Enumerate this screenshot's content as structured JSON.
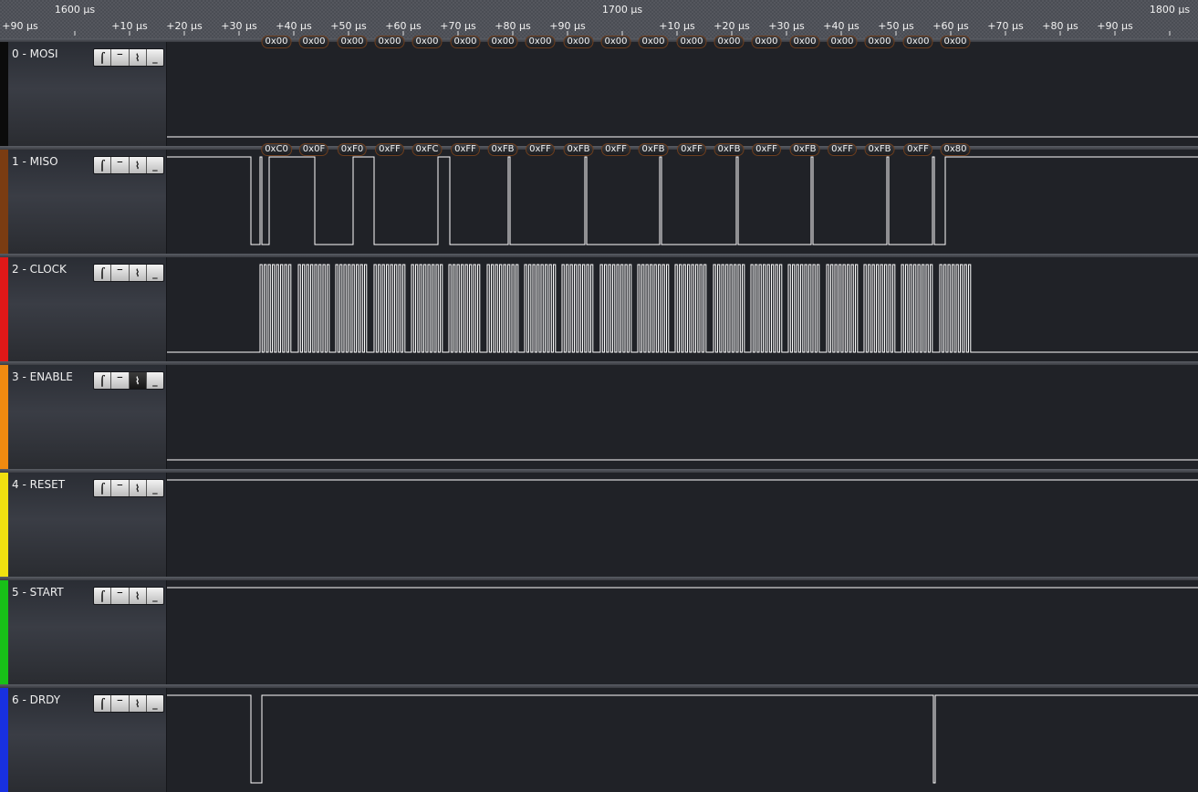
{
  "ruler": {
    "major_labels": [
      "1600 µs",
      "1700 µs",
      "1800 µs"
    ],
    "minor_labels": [
      "+90 µs",
      "+10 µs",
      "+20 µs",
      "+30 µs",
      "+40 µs",
      "+50 µs",
      "+60 µs",
      "+70 µs",
      "+80 µs",
      "+90 µs",
      "+10 µs",
      "+20 µs",
      "+30 µs",
      "+40 µs",
      "+50 µs",
      "+60 µs",
      "+70 µs",
      "+80 µs",
      "+90 µs"
    ]
  },
  "trigger_glyphs": [
    "⌠",
    "‾",
    "⌇",
    "_"
  ],
  "channels": [
    {
      "label": "0 - MOSI",
      "color": "#0b0b0b",
      "trigger_active": -1,
      "decoded": [
        "0x00",
        "0x00",
        "0x00",
        "0x00",
        "0x00",
        "0x00",
        "0x00",
        "0x00",
        "0x00",
        "0x00",
        "0x00",
        "0x00",
        "0x00",
        "0x00",
        "0x00",
        "0x00",
        "0x00",
        "0x00",
        "0x00"
      ]
    },
    {
      "label": "1 - MISO",
      "color": "#7a3c12",
      "trigger_active": -1,
      "decoded": [
        "0xC0",
        "0x0F",
        "0xF0",
        "0xFF",
        "0xFC",
        "0xFF",
        "0xFB",
        "0xFF",
        "0xFB",
        "0xFF",
        "0xFB",
        "0xFF",
        "0xFB",
        "0xFF",
        "0xFB",
        "0xFF",
        "0xFB",
        "0xFF",
        "0x80"
      ]
    },
    {
      "label": "2 - CLOCK",
      "color": "#e01818",
      "trigger_active": -1,
      "decoded": []
    },
    {
      "label": "3 - ENABLE",
      "color": "#f08a10",
      "trigger_active": 2,
      "decoded": []
    },
    {
      "label": "4 - RESET",
      "color": "#f0e010",
      "trigger_active": -1,
      "decoded": []
    },
    {
      "label": "5 - START",
      "color": "#18c018",
      "trigger_active": -1,
      "decoded": []
    },
    {
      "label": "6 - DRDY",
      "color": "#1830e0",
      "trigger_active": -1,
      "decoded": []
    }
  ]
}
